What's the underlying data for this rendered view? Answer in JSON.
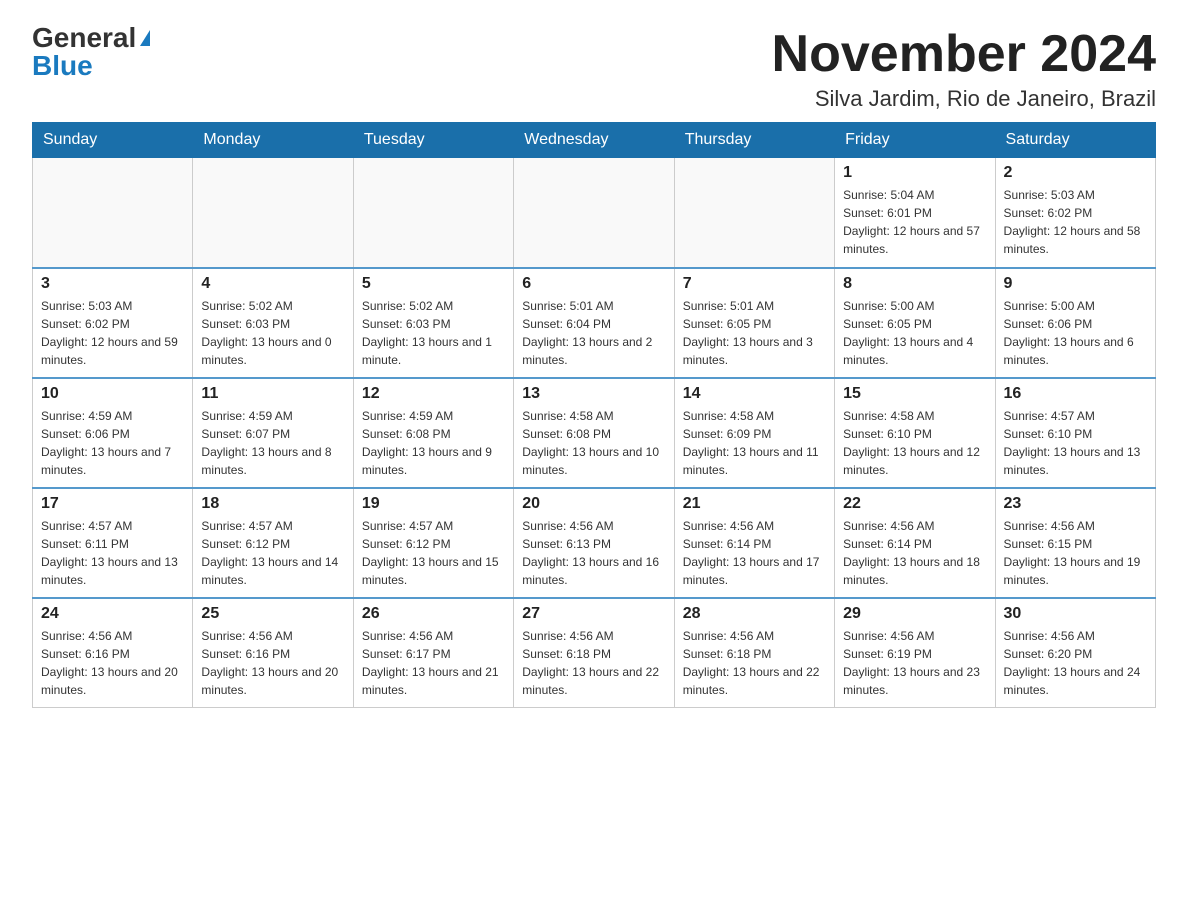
{
  "header": {
    "logo_general": "General",
    "logo_blue": "Blue",
    "month_title": "November 2024",
    "location": "Silva Jardim, Rio de Janeiro, Brazil"
  },
  "weekdays": [
    "Sunday",
    "Monday",
    "Tuesday",
    "Wednesday",
    "Thursday",
    "Friday",
    "Saturday"
  ],
  "weeks": [
    [
      {
        "day": "",
        "info": ""
      },
      {
        "day": "",
        "info": ""
      },
      {
        "day": "",
        "info": ""
      },
      {
        "day": "",
        "info": ""
      },
      {
        "day": "",
        "info": ""
      },
      {
        "day": "1",
        "info": "Sunrise: 5:04 AM\nSunset: 6:01 PM\nDaylight: 12 hours and 57 minutes."
      },
      {
        "day": "2",
        "info": "Sunrise: 5:03 AM\nSunset: 6:02 PM\nDaylight: 12 hours and 58 minutes."
      }
    ],
    [
      {
        "day": "3",
        "info": "Sunrise: 5:03 AM\nSunset: 6:02 PM\nDaylight: 12 hours and 59 minutes."
      },
      {
        "day": "4",
        "info": "Sunrise: 5:02 AM\nSunset: 6:03 PM\nDaylight: 13 hours and 0 minutes."
      },
      {
        "day": "5",
        "info": "Sunrise: 5:02 AM\nSunset: 6:03 PM\nDaylight: 13 hours and 1 minute."
      },
      {
        "day": "6",
        "info": "Sunrise: 5:01 AM\nSunset: 6:04 PM\nDaylight: 13 hours and 2 minutes."
      },
      {
        "day": "7",
        "info": "Sunrise: 5:01 AM\nSunset: 6:05 PM\nDaylight: 13 hours and 3 minutes."
      },
      {
        "day": "8",
        "info": "Sunrise: 5:00 AM\nSunset: 6:05 PM\nDaylight: 13 hours and 4 minutes."
      },
      {
        "day": "9",
        "info": "Sunrise: 5:00 AM\nSunset: 6:06 PM\nDaylight: 13 hours and 6 minutes."
      }
    ],
    [
      {
        "day": "10",
        "info": "Sunrise: 4:59 AM\nSunset: 6:06 PM\nDaylight: 13 hours and 7 minutes."
      },
      {
        "day": "11",
        "info": "Sunrise: 4:59 AM\nSunset: 6:07 PM\nDaylight: 13 hours and 8 minutes."
      },
      {
        "day": "12",
        "info": "Sunrise: 4:59 AM\nSunset: 6:08 PM\nDaylight: 13 hours and 9 minutes."
      },
      {
        "day": "13",
        "info": "Sunrise: 4:58 AM\nSunset: 6:08 PM\nDaylight: 13 hours and 10 minutes."
      },
      {
        "day": "14",
        "info": "Sunrise: 4:58 AM\nSunset: 6:09 PM\nDaylight: 13 hours and 11 minutes."
      },
      {
        "day": "15",
        "info": "Sunrise: 4:58 AM\nSunset: 6:10 PM\nDaylight: 13 hours and 12 minutes."
      },
      {
        "day": "16",
        "info": "Sunrise: 4:57 AM\nSunset: 6:10 PM\nDaylight: 13 hours and 13 minutes."
      }
    ],
    [
      {
        "day": "17",
        "info": "Sunrise: 4:57 AM\nSunset: 6:11 PM\nDaylight: 13 hours and 13 minutes."
      },
      {
        "day": "18",
        "info": "Sunrise: 4:57 AM\nSunset: 6:12 PM\nDaylight: 13 hours and 14 minutes."
      },
      {
        "day": "19",
        "info": "Sunrise: 4:57 AM\nSunset: 6:12 PM\nDaylight: 13 hours and 15 minutes."
      },
      {
        "day": "20",
        "info": "Sunrise: 4:56 AM\nSunset: 6:13 PM\nDaylight: 13 hours and 16 minutes."
      },
      {
        "day": "21",
        "info": "Sunrise: 4:56 AM\nSunset: 6:14 PM\nDaylight: 13 hours and 17 minutes."
      },
      {
        "day": "22",
        "info": "Sunrise: 4:56 AM\nSunset: 6:14 PM\nDaylight: 13 hours and 18 minutes."
      },
      {
        "day": "23",
        "info": "Sunrise: 4:56 AM\nSunset: 6:15 PM\nDaylight: 13 hours and 19 minutes."
      }
    ],
    [
      {
        "day": "24",
        "info": "Sunrise: 4:56 AM\nSunset: 6:16 PM\nDaylight: 13 hours and 20 minutes."
      },
      {
        "day": "25",
        "info": "Sunrise: 4:56 AM\nSunset: 6:16 PM\nDaylight: 13 hours and 20 minutes."
      },
      {
        "day": "26",
        "info": "Sunrise: 4:56 AM\nSunset: 6:17 PM\nDaylight: 13 hours and 21 minutes."
      },
      {
        "day": "27",
        "info": "Sunrise: 4:56 AM\nSunset: 6:18 PM\nDaylight: 13 hours and 22 minutes."
      },
      {
        "day": "28",
        "info": "Sunrise: 4:56 AM\nSunset: 6:18 PM\nDaylight: 13 hours and 22 minutes."
      },
      {
        "day": "29",
        "info": "Sunrise: 4:56 AM\nSunset: 6:19 PM\nDaylight: 13 hours and 23 minutes."
      },
      {
        "day": "30",
        "info": "Sunrise: 4:56 AM\nSunset: 6:20 PM\nDaylight: 13 hours and 24 minutes."
      }
    ]
  ]
}
